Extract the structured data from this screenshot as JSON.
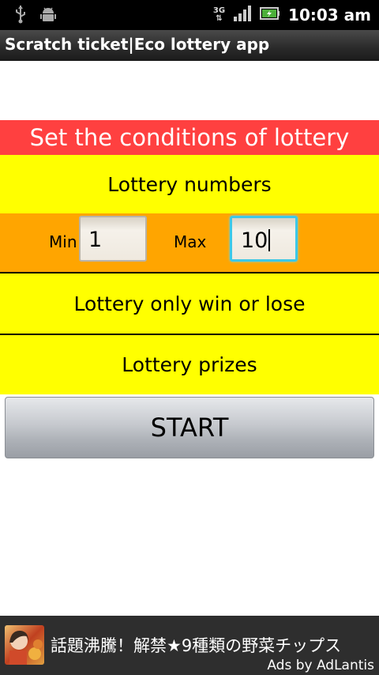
{
  "status_bar": {
    "network": "3G",
    "time": "10:03 am"
  },
  "app": {
    "title": "Scratch ticket|Eco lottery app"
  },
  "conditions": {
    "header": "Set the conditions of lottery",
    "lottery_numbers_label": "Lottery numbers",
    "min_label": "Min",
    "min_value": "1",
    "max_label": "Max",
    "max_value": "10",
    "win_or_lose_label": "Lottery only win or lose",
    "prizes_label": "Lottery prizes"
  },
  "start_button": {
    "label": "START"
  },
  "ad": {
    "text": "話題沸騰！解禁★9種類の野菜チップス",
    "credit": "Ads by AdLantis"
  },
  "colors": {
    "header_bg": "#ff4040",
    "yellow_row_bg": "#ffff00",
    "range_row_bg": "#ffa500",
    "focus_border": "#3cc8e8"
  }
}
